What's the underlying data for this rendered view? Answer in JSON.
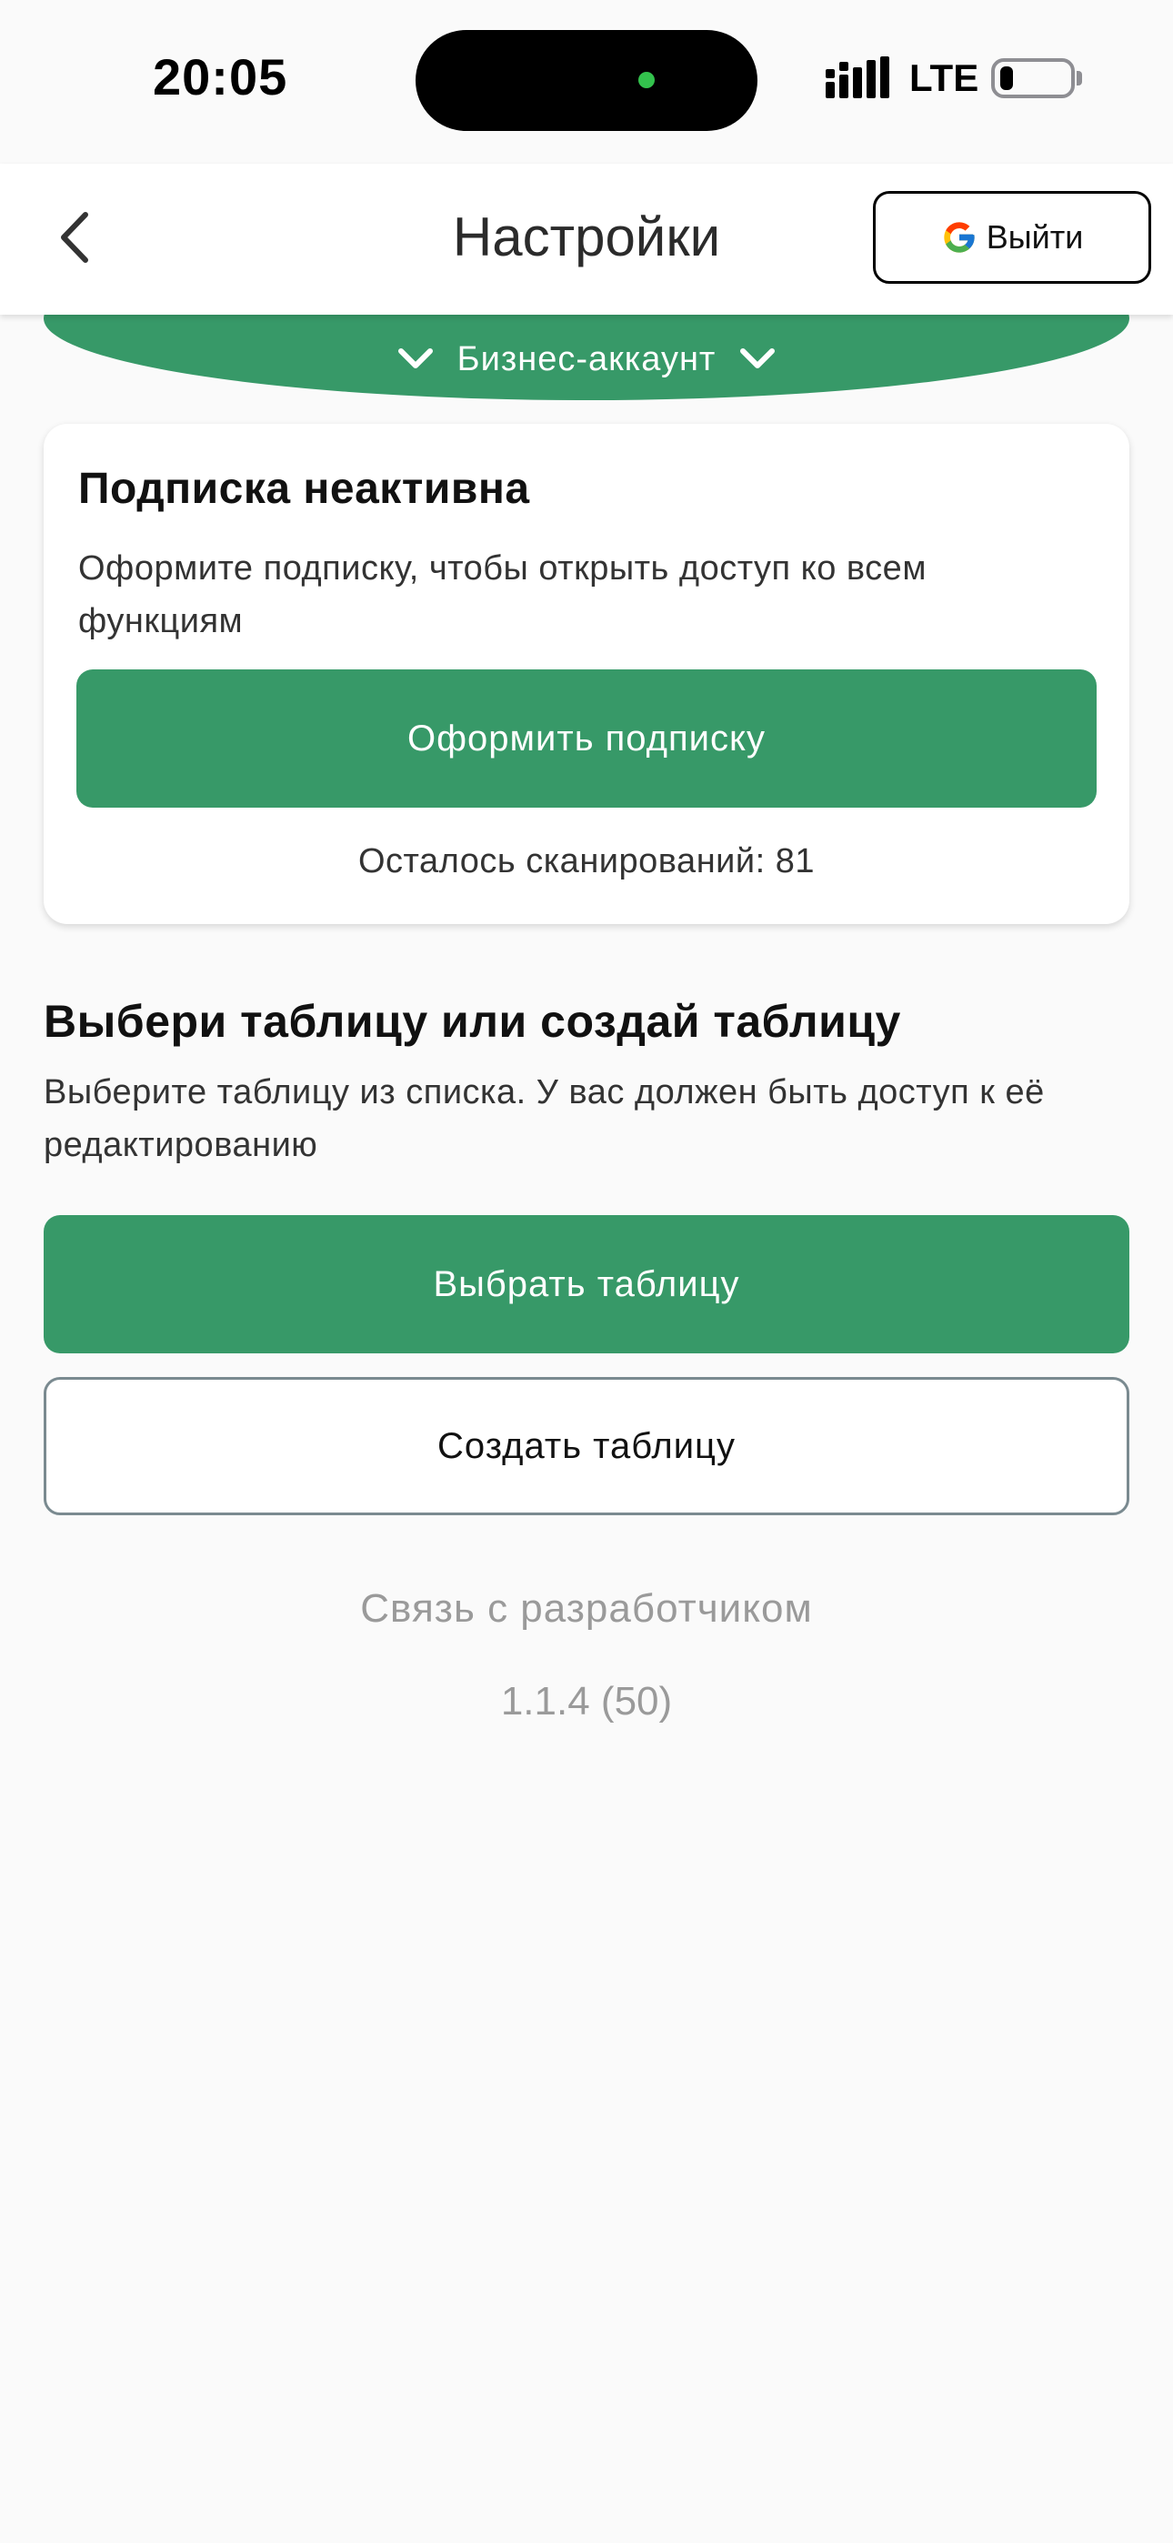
{
  "status_bar": {
    "time": "20:05",
    "network": "LTE",
    "island_dot_color": "#33c24d"
  },
  "header": {
    "title": "Настройки",
    "back_icon": "chevron-left-icon",
    "logout_label": "Выйти",
    "logout_icon": "google-g-icon"
  },
  "account": {
    "label": "Бизнес-аккаунт",
    "icon": "chevron-down-icon"
  },
  "subscription": {
    "title": "Подписка неактивна",
    "description": "Оформите подписку, чтобы открыть доступ ко всем функциям",
    "button_label": "Оформить подписку",
    "scans_left": "Осталось сканирований: 81"
  },
  "table": {
    "heading": "Выбери таблицу или создай таблицу",
    "description": "Выберите таблицу из списка. У вас должен быть доступ к её редактированию",
    "choose_label": "Выбрать таблицу",
    "create_label": "Создать таблицу"
  },
  "footer": {
    "contact": "Связь с разработчиком",
    "version": "1.1.4 (50)"
  },
  "colors": {
    "accent": "#379968",
    "background": "#fafafa",
    "muted_text": "#9a9a9a"
  }
}
